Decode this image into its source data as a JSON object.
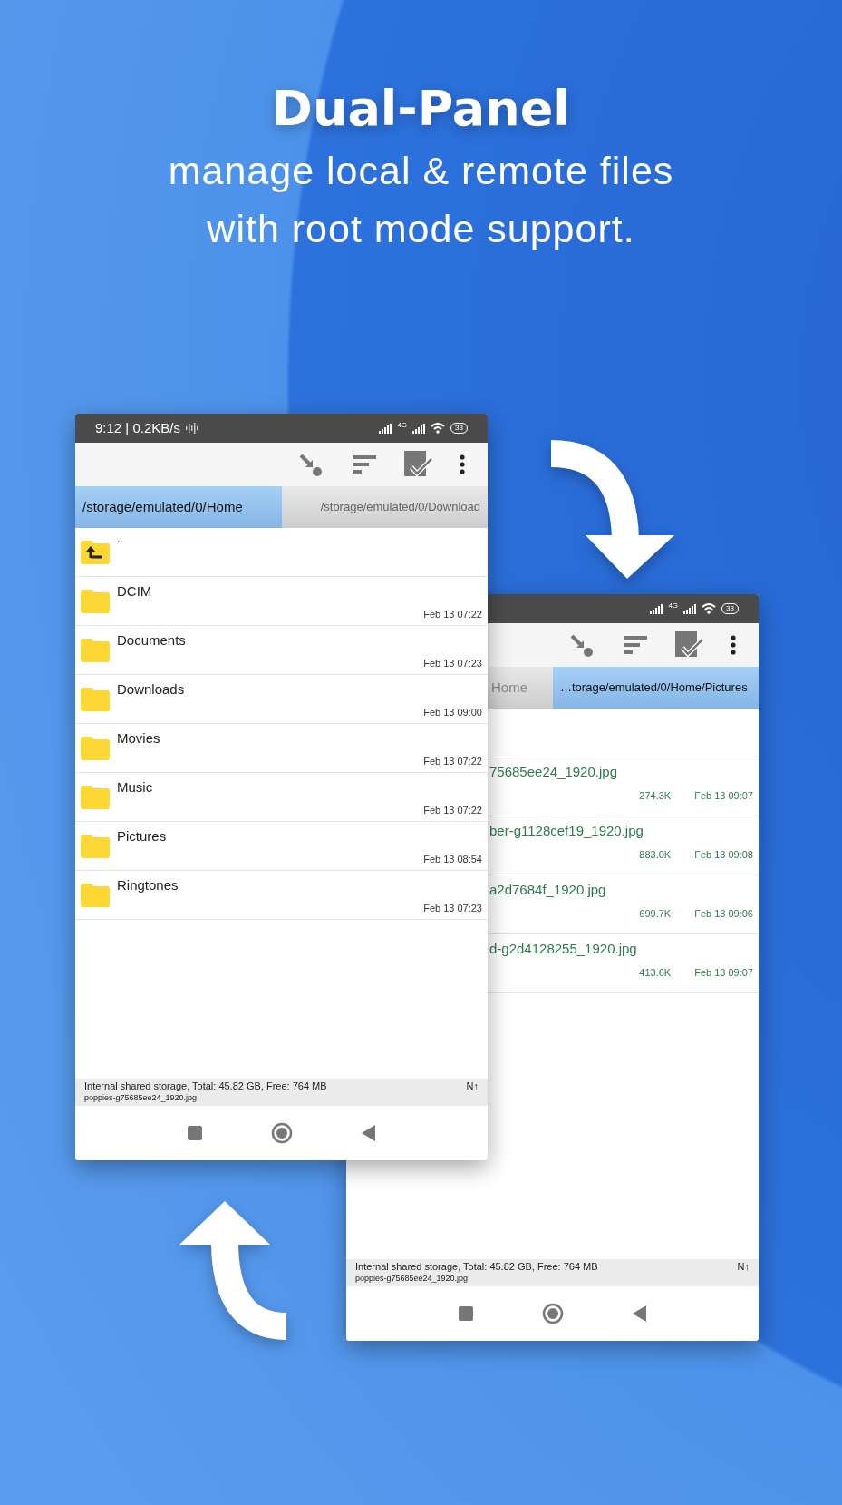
{
  "header": {
    "title": "Dual-Panel",
    "subtitle_lines": [
      "manage local & remote files",
      "with root mode support."
    ]
  },
  "phones": [
    {
      "status_bar": {
        "time": "9:12 | 0.2KB/s",
        "network": "4G",
        "battery": "33"
      },
      "tabs": [
        {
          "label": "/storage/emulated/0/Home",
          "selected": true
        },
        {
          "label": "/storage/emulated/0/Download",
          "selected": false
        }
      ],
      "rows": [
        {
          "kind": "parent",
          "name": ".."
        },
        {
          "kind": "folder",
          "name": "DCIM",
          "date": "Feb 13 07:22"
        },
        {
          "kind": "folder",
          "name": "Documents",
          "date": "Feb 13 07:23"
        },
        {
          "kind": "folder",
          "name": "Downloads",
          "date": "Feb 13 09:00"
        },
        {
          "kind": "folder",
          "name": "Movies",
          "date": "Feb 13 07:22"
        },
        {
          "kind": "folder",
          "name": "Music",
          "date": "Feb 13 07:22"
        },
        {
          "kind": "folder",
          "name": "Pictures",
          "date": "Feb 13 08:54"
        },
        {
          "kind": "folder",
          "name": "Ringtones",
          "date": "Feb 13 07:23"
        }
      ],
      "storage_info": "Internal shared storage, Total: 45.82 GB, Free: 764 MB",
      "sort_indicator": "N↑",
      "selected_file": "poppies-g75685ee24_1920.jpg"
    },
    {
      "status_bar": {
        "network": "4G",
        "battery": "33"
      },
      "tabs": [
        {
          "label": "Home",
          "selected": false
        },
        {
          "label": "…torage/emulated/0/Home/Pictures",
          "selected": true
        }
      ],
      "rows": [
        {
          "kind": "spacer"
        },
        {
          "kind": "file",
          "name": "75685ee24_1920.jpg",
          "size": "274.3K",
          "date": "Feb 13 09:07"
        },
        {
          "kind": "file",
          "name": "ber-g1128cef19_1920.jpg",
          "size": "883.0K",
          "date": "Feb 13 09:08"
        },
        {
          "kind": "file",
          "name": "a2d7684f_1920.jpg",
          "size": "699.7K",
          "date": "Feb 13 09:06"
        },
        {
          "kind": "file",
          "name": "d-g2d4128255_1920.jpg",
          "size": "413.6K",
          "date": "Feb 13 09:07"
        }
      ],
      "storage_info": "Internal shared storage, Total: 45.82 GB, Free: 764 MB",
      "sort_indicator": "N↑",
      "selected_file": "poppies-g75685ee24_1920.jpg"
    }
  ]
}
